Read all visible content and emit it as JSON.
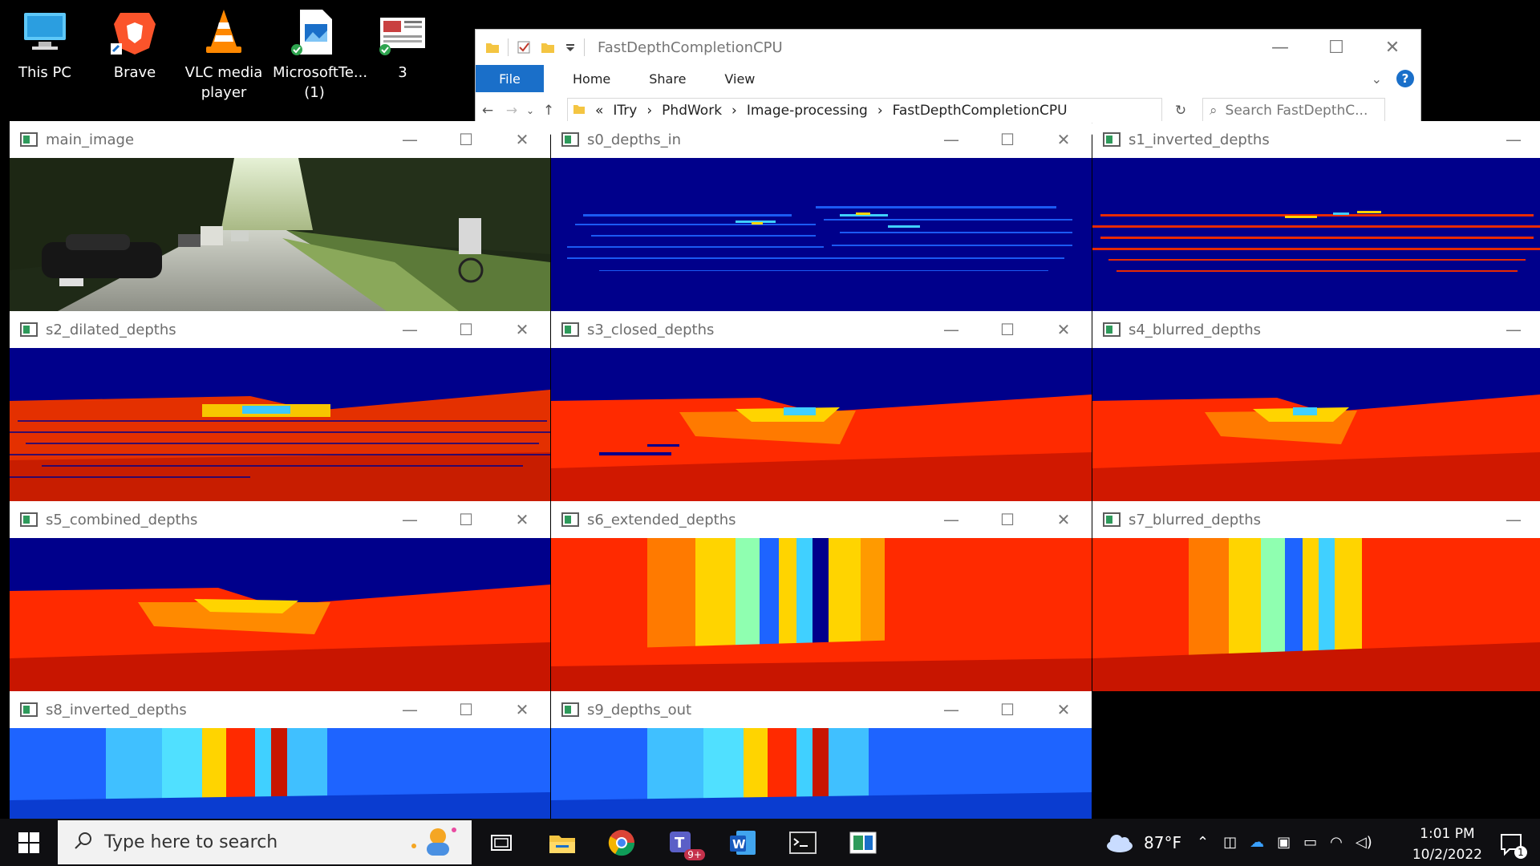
{
  "desktop": {
    "icons": [
      {
        "label": "This PC",
        "icon": "computer-icon"
      },
      {
        "label": "Brave",
        "icon": "brave-icon"
      },
      {
        "label": "VLC media player",
        "icon": "vlc-icon"
      },
      {
        "label": "MicrosoftTe... (1)",
        "icon": "image-file-icon"
      },
      {
        "label": "3",
        "icon": "document-thumbnail-icon"
      }
    ]
  },
  "explorer": {
    "title": "FastDepthCompletionCPU",
    "ribbon_tabs": [
      "File",
      "Home",
      "Share",
      "View"
    ],
    "breadcrumb": [
      "«",
      "ITry",
      "PhdWork",
      "Image-processing",
      "FastDepthCompletionCPU"
    ],
    "search_placeholder": "Search FastDepthC..."
  },
  "windows": [
    {
      "title": "main_image"
    },
    {
      "title": "s0_depths_in"
    },
    {
      "title": "s1_inverted_depths"
    },
    {
      "title": "s2_dilated_depths"
    },
    {
      "title": "s3_closed_depths"
    },
    {
      "title": "s4_blurred_depths"
    },
    {
      "title": "s5_combined_depths"
    },
    {
      "title": "s6_extended_depths"
    },
    {
      "title": "s7_blurred_depths"
    },
    {
      "title": "s8_inverted_depths"
    },
    {
      "title": "s9_depths_out"
    }
  ],
  "taskbar": {
    "search_placeholder": "Type here to search",
    "weather": "87°F",
    "time": "1:01 PM",
    "date": "10/2/2022",
    "notification_count": "1",
    "teams_badge": "9+"
  },
  "colors": {
    "depth_far": "#00008b",
    "depth_mid": "#ffd400",
    "depth_near": "#ff2a00",
    "accent": "#1a6fc9"
  }
}
